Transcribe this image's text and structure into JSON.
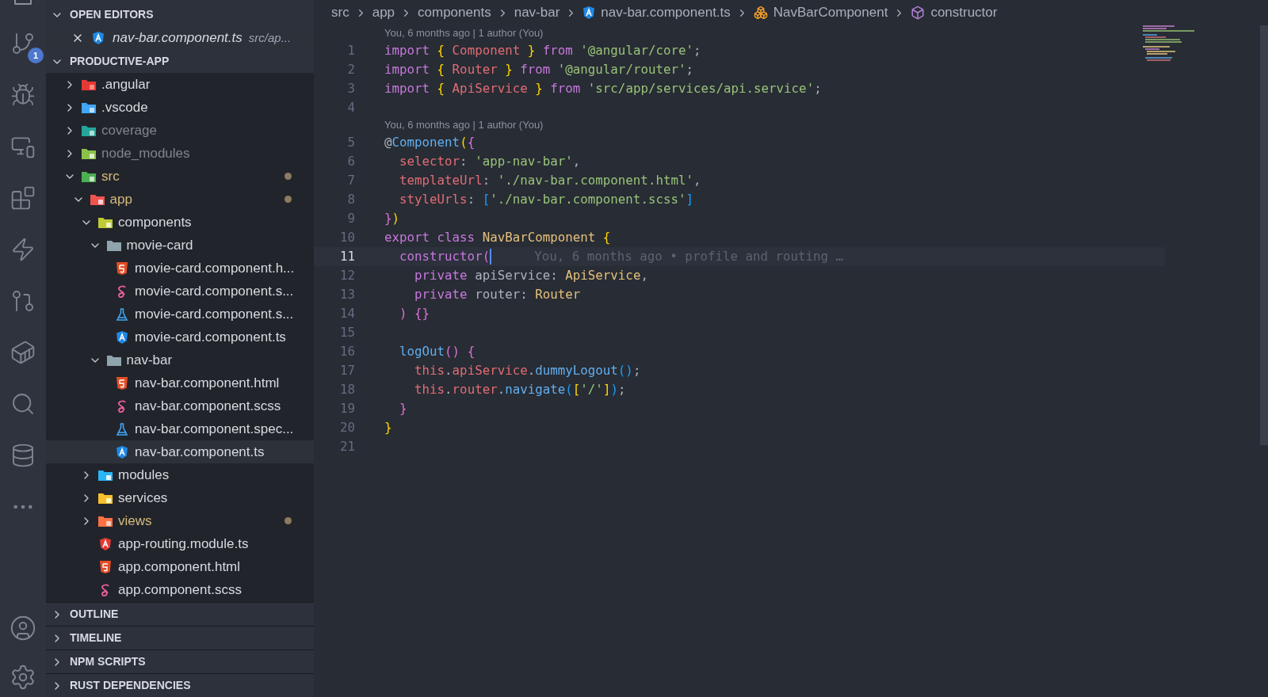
{
  "activity_bar": {
    "badge": "1"
  },
  "sidebar": {
    "open_editors": {
      "title": "OPEN EDITORS",
      "expanded": true,
      "items": [
        {
          "name": "nav-bar.component.ts",
          "path": "src/ap...",
          "kind": "angular"
        }
      ]
    },
    "project": {
      "title": "PRODUCTIVE-APP",
      "expanded": true,
      "tree": [
        {
          "name": ".angular",
          "kind": "folder-angular",
          "expanded": false,
          "dimmed": false,
          "modified": false,
          "selected": false
        },
        {
          "name": ".vscode",
          "kind": "folder-vscode",
          "expanded": false,
          "dimmed": false,
          "modified": false,
          "selected": false
        },
        {
          "name": "coverage",
          "kind": "folder-coverage",
          "expanded": false,
          "dimmed": true,
          "modified": false,
          "selected": false
        },
        {
          "name": "node_modules",
          "kind": "folder-node",
          "expanded": false,
          "dimmed": true,
          "modified": false,
          "selected": false
        },
        {
          "name": "src",
          "kind": "folder-src",
          "expanded": true,
          "dimmed": false,
          "modified": true,
          "selected": false,
          "children": [
            {
              "name": "app",
              "kind": "folder-app",
              "expanded": true,
              "dimmed": false,
              "modified": true,
              "selected": false,
              "children": [
                {
                  "name": "components",
                  "kind": "folder-components",
                  "expanded": true,
                  "dimmed": false,
                  "modified": false,
                  "selected": false,
                  "children": [
                    {
                      "name": "movie-card",
                      "kind": "folder",
                      "expanded": true,
                      "dimmed": false,
                      "modified": false,
                      "selected": false,
                      "children": [
                        {
                          "name": "movie-card.component.h...",
                          "kind": "html",
                          "dimmed": false,
                          "modified": false,
                          "selected": false
                        },
                        {
                          "name": "movie-card.component.s...",
                          "kind": "scss",
                          "dimmed": false,
                          "modified": false,
                          "selected": false
                        },
                        {
                          "name": "movie-card.component.s...",
                          "kind": "spec",
                          "dimmed": false,
                          "modified": false,
                          "selected": false
                        },
                        {
                          "name": "movie-card.component.ts",
                          "kind": "angular",
                          "dimmed": false,
                          "modified": false,
                          "selected": false
                        }
                      ]
                    },
                    {
                      "name": "nav-bar",
                      "kind": "folder",
                      "expanded": true,
                      "dimmed": false,
                      "modified": false,
                      "selected": false,
                      "children": [
                        {
                          "name": "nav-bar.component.html",
                          "kind": "html",
                          "dimmed": false,
                          "modified": false,
                          "selected": false
                        },
                        {
                          "name": "nav-bar.component.scss",
                          "kind": "scss",
                          "dimmed": false,
                          "modified": false,
                          "selected": false
                        },
                        {
                          "name": "nav-bar.component.spec...",
                          "kind": "spec",
                          "dimmed": false,
                          "modified": false,
                          "selected": false
                        },
                        {
                          "name": "nav-bar.component.ts",
                          "kind": "angular",
                          "dimmed": false,
                          "modified": false,
                          "selected": true
                        }
                      ]
                    }
                  ]
                },
                {
                  "name": "modules",
                  "kind": "folder-modules",
                  "expanded": false,
                  "dimmed": false,
                  "modified": false,
                  "selected": false
                },
                {
                  "name": "services",
                  "kind": "folder-services",
                  "expanded": false,
                  "dimmed": false,
                  "modified": false,
                  "selected": false
                },
                {
                  "name": "views",
                  "kind": "folder-views",
                  "expanded": false,
                  "dimmed": false,
                  "modified": true,
                  "selected": false
                },
                {
                  "name": "app-routing.module.ts",
                  "kind": "angular-module",
                  "dimmed": false,
                  "modified": false,
                  "selected": false
                },
                {
                  "name": "app.component.html",
                  "kind": "html",
                  "dimmed": false,
                  "modified": false,
                  "selected": false
                },
                {
                  "name": "app.component.scss",
                  "kind": "scss",
                  "dimmed": false,
                  "modified": false,
                  "selected": false
                }
              ]
            }
          ]
        }
      ]
    },
    "panels": [
      {
        "title": "OUTLINE",
        "expanded": false
      },
      {
        "title": "TIMELINE",
        "expanded": false
      },
      {
        "title": "NPM SCRIPTS",
        "expanded": false
      },
      {
        "title": "RUST DEPENDENCIES",
        "expanded": false
      }
    ]
  },
  "breadcrumbs": [
    {
      "label": "src",
      "kind": "folder"
    },
    {
      "label": "app",
      "kind": "folder"
    },
    {
      "label": "components",
      "kind": "folder"
    },
    {
      "label": "nav-bar",
      "kind": "folder"
    },
    {
      "label": "nav-bar.component.ts",
      "kind": "file"
    },
    {
      "label": "NavBarComponent",
      "kind": "class"
    },
    {
      "label": "constructor",
      "kind": "method"
    }
  ],
  "editor": {
    "lines": [
      {
        "number": "1",
        "current": false,
        "codelens": "You, 6 months ago | 1 author (You)",
        "tokens": [
          {
            "text": "import ",
            "kind": "kw"
          },
          {
            "text": "{",
            "kind": "b1"
          },
          {
            "text": " Component ",
            "kind": "cls"
          },
          {
            "text": "}",
            "kind": "b1"
          },
          {
            "text": " from ",
            "kind": "kw"
          },
          {
            "text": "'@angular/core'",
            "kind": "str"
          },
          {
            "text": ";",
            "kind": "punct"
          }
        ]
      },
      {
        "number": "2",
        "current": false,
        "tokens": [
          {
            "text": "import ",
            "kind": "kw"
          },
          {
            "text": "{",
            "kind": "b1"
          },
          {
            "text": " Router ",
            "kind": "cls"
          },
          {
            "text": "}",
            "kind": "b1"
          },
          {
            "text": " from ",
            "kind": "kw"
          },
          {
            "text": "'@angular/router'",
            "kind": "str"
          },
          {
            "text": ";",
            "kind": "punct"
          }
        ]
      },
      {
        "number": "3",
        "current": false,
        "tokens": [
          {
            "text": "import ",
            "kind": "kw"
          },
          {
            "text": "{",
            "kind": "b1"
          },
          {
            "text": " ApiService ",
            "kind": "cls"
          },
          {
            "text": "}",
            "kind": "b1"
          },
          {
            "text": " from ",
            "kind": "kw"
          },
          {
            "text": "'src/app/services/api.service'",
            "kind": "str"
          },
          {
            "text": ";",
            "kind": "punct"
          }
        ]
      },
      {
        "number": "4",
        "current": false
      },
      {
        "number": "5",
        "current": false,
        "codelens": "You, 6 months ago | 1 author (You)",
        "tokens": [
          {
            "text": "@",
            "kind": "plain"
          },
          {
            "text": "Component",
            "kind": "fn"
          },
          {
            "text": "(",
            "kind": "b1"
          },
          {
            "text": "{",
            "kind": "b2"
          }
        ]
      },
      {
        "number": "6",
        "current": false,
        "tokens": [
          {
            "text": "  selector",
            "kind": "prop"
          },
          {
            "text": ": ",
            "kind": "punct"
          },
          {
            "text": "'app-nav-bar'",
            "kind": "str"
          },
          {
            "text": ",",
            "kind": "punct"
          }
        ]
      },
      {
        "number": "7",
        "current": false,
        "tokens": [
          {
            "text": "  templateUrl",
            "kind": "prop"
          },
          {
            "text": ": ",
            "kind": "punct"
          },
          {
            "text": "'./nav-bar.component.html'",
            "kind": "str"
          },
          {
            "text": ",",
            "kind": "punct"
          }
        ]
      },
      {
        "number": "8",
        "current": false,
        "tokens": [
          {
            "text": "  styleUrls",
            "kind": "prop"
          },
          {
            "text": ": ",
            "kind": "punct"
          },
          {
            "text": "[",
            "kind": "b3"
          },
          {
            "text": "'./nav-bar.component.scss'",
            "kind": "str"
          },
          {
            "text": "]",
            "kind": "b3"
          }
        ]
      },
      {
        "number": "9",
        "current": false,
        "tokens": [
          {
            "text": "}",
            "kind": "b2"
          },
          {
            "text": ")",
            "kind": "b1"
          }
        ]
      },
      {
        "number": "10",
        "current": false,
        "tokens": [
          {
            "text": "export class ",
            "kind": "kw"
          },
          {
            "text": "NavBarComponent",
            "kind": "type"
          },
          {
            "text": " {",
            "kind": "b1"
          }
        ]
      },
      {
        "number": "11",
        "current": true,
        "inline_blame": "You, 6 months ago • profile and routing …",
        "tokens": [
          {
            "text": "  constructor",
            "kind": "kw"
          },
          {
            "text": "(",
            "kind": "b2"
          }
        ]
      },
      {
        "number": "12",
        "current": false,
        "tokens": [
          {
            "text": "    private ",
            "kind": "kw"
          },
          {
            "text": "apiService",
            "kind": "plain"
          },
          {
            "text": ": ",
            "kind": "punct"
          },
          {
            "text": "ApiService",
            "kind": "type"
          },
          {
            "text": ",",
            "kind": "punct"
          }
        ]
      },
      {
        "number": "13",
        "current": false,
        "tokens": [
          {
            "text": "    private ",
            "kind": "kw"
          },
          {
            "text": "router",
            "kind": "plain"
          },
          {
            "text": ": ",
            "kind": "punct"
          },
          {
            "text": "Router",
            "kind": "type"
          }
        ]
      },
      {
        "number": "14",
        "current": false,
        "tokens": [
          {
            "text": "  )",
            "kind": "b2"
          },
          {
            "text": " {}",
            "kind": "b2"
          }
        ]
      },
      {
        "number": "15",
        "current": false
      },
      {
        "number": "16",
        "current": false,
        "tokens": [
          {
            "text": "  logOut",
            "kind": "fn"
          },
          {
            "text": "()",
            "kind": "b2"
          },
          {
            "text": " {",
            "kind": "b2"
          }
        ]
      },
      {
        "number": "17",
        "current": false,
        "tokens": [
          {
            "text": "    this",
            "kind": "this"
          },
          {
            "text": ".",
            "kind": "punct"
          },
          {
            "text": "apiService",
            "kind": "this"
          },
          {
            "text": ".",
            "kind": "punct"
          },
          {
            "text": "dummyLogout",
            "kind": "fn"
          },
          {
            "text": "()",
            "kind": "b3"
          },
          {
            "text": ";",
            "kind": "punct"
          }
        ]
      },
      {
        "number": "18",
        "current": false,
        "tokens": [
          {
            "text": "    this",
            "kind": "this"
          },
          {
            "text": ".",
            "kind": "punct"
          },
          {
            "text": "router",
            "kind": "this"
          },
          {
            "text": ".",
            "kind": "punct"
          },
          {
            "text": "navigate",
            "kind": "fn"
          },
          {
            "text": "(",
            "kind": "b3"
          },
          {
            "text": "[",
            "kind": "b1"
          },
          {
            "text": "'/'",
            "kind": "str"
          },
          {
            "text": "]",
            "kind": "b1"
          },
          {
            "text": ")",
            "kind": "b3"
          },
          {
            "text": ";",
            "kind": "punct"
          }
        ]
      },
      {
        "number": "19",
        "current": false,
        "tokens": [
          {
            "text": "  }",
            "kind": "b2"
          }
        ]
      },
      {
        "number": "20",
        "current": false,
        "tokens": [
          {
            "text": "}",
            "kind": "b1"
          }
        ]
      },
      {
        "number": "21",
        "current": false
      }
    ]
  }
}
